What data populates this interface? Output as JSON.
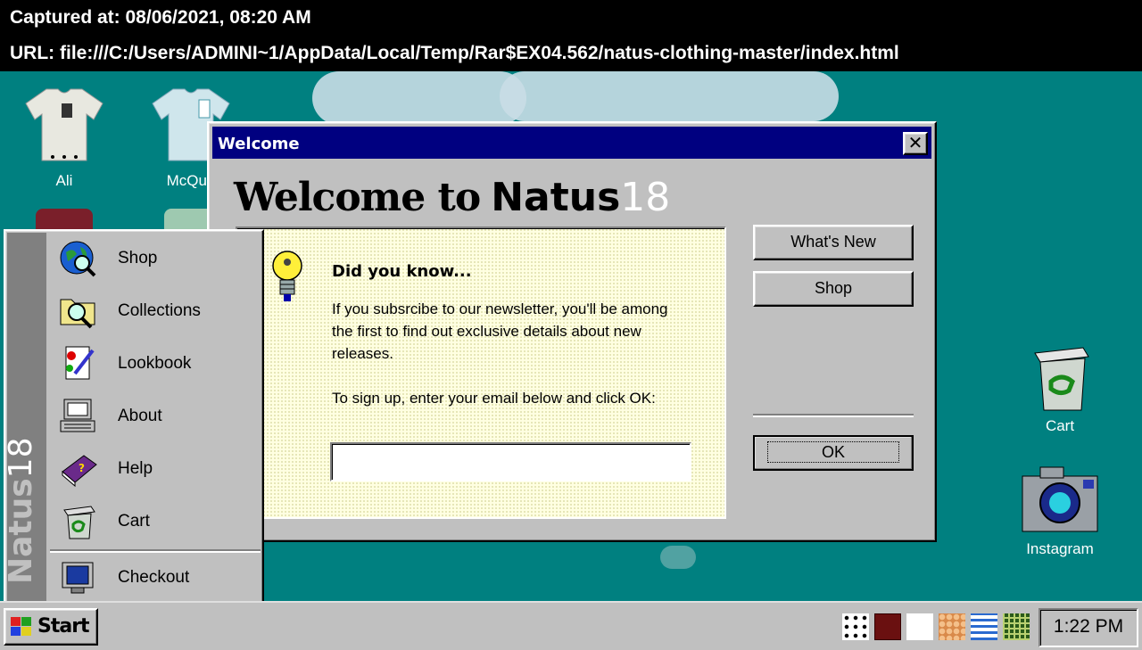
{
  "capture": {
    "time": "Captured at: 08/06/2021, 08:20 AM",
    "url": "URL: file:///C:/Users/ADMINI~1/AppData/Local/Temp/Rar$EX04.562/natus-clothing-master/index.html"
  },
  "desktop_icons": {
    "left": [
      {
        "label": "Ali"
      },
      {
        "label": "McQue"
      }
    ],
    "right": [
      {
        "label": "Cart",
        "icon": "recycle-bin-icon"
      },
      {
        "label": "Instagram",
        "icon": "camera-icon"
      }
    ]
  },
  "welcome": {
    "window_title": "Welcome",
    "close_label": "✕",
    "heading_prefix": "Welcome to",
    "brand": "Natus",
    "brand_number": "18",
    "tip_title": "Did you know...",
    "tip_p1": "If you subsrcibe to our newsletter, you'll be among the first to find out exclusive details about new releases.",
    "tip_p2": "To sign up, enter your email below and click OK:",
    "email_value": "",
    "buttons": {
      "whats_new": "What's New",
      "shop": "Shop",
      "ok": "OK"
    }
  },
  "start_menu": {
    "brand": "Natus",
    "brand_number": "18",
    "items": [
      {
        "label": "Shop",
        "icon": "globe-search-icon"
      },
      {
        "label": "Collections",
        "icon": "folder-search-icon"
      },
      {
        "label": "Lookbook",
        "icon": "paint-document-icon"
      },
      {
        "label": "About",
        "icon": "computer-info-icon"
      },
      {
        "label": "Help",
        "icon": "help-book-icon"
      },
      {
        "label": "Cart",
        "icon": "recycle-bin-icon"
      },
      {
        "label": "Checkout",
        "icon": "monitor-icon"
      }
    ]
  },
  "taskbar": {
    "start_label": "Start",
    "clock": "1:22 PM",
    "tray_icons": [
      "dice-icon",
      "dark-tile-icon",
      "qr-icon",
      "pattern-icon",
      "list-icon",
      "grid-icon"
    ]
  },
  "colors": {
    "desktop": "#008080",
    "titlebar": "#000080",
    "face": "#c0c0c0",
    "tip_bg": "#ffffe1"
  }
}
